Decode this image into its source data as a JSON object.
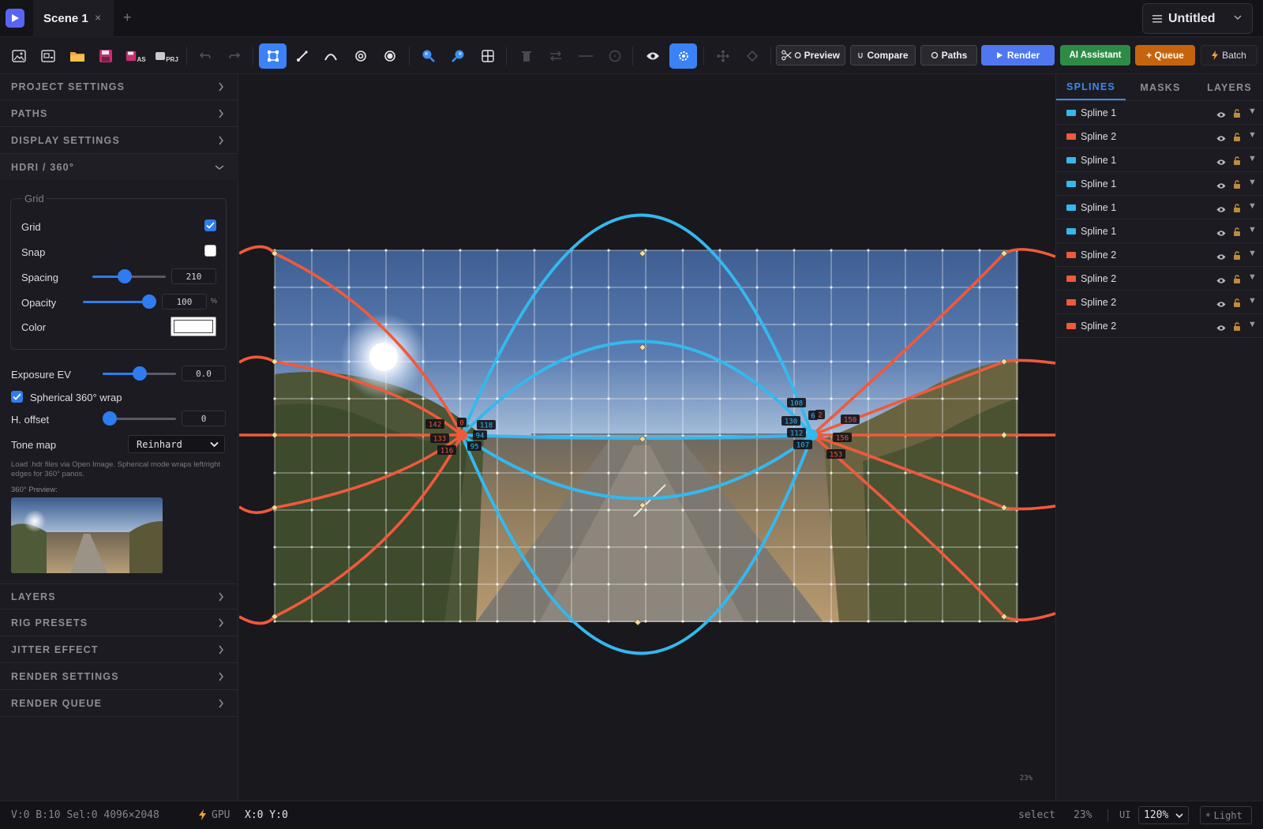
{
  "tabbar": {
    "tab_label": "Scene 1",
    "close": "×",
    "add": "+",
    "project_name": "Untitled"
  },
  "toolbar": {
    "icons": [
      "image-icon",
      "save-as-image-icon",
      "folder-open-icon",
      "save-icon",
      "save-as-icon",
      "save-project-icon",
      "undo-icon",
      "redo-icon",
      "select-tool-icon",
      "pen-tool-icon",
      "curve-tool-icon",
      "ring-tool-icon",
      "point-tool-icon",
      "zoom-in-icon",
      "zoom-out-icon",
      "grid-icon",
      "delete-icon",
      "swap-icon",
      "line-icon",
      "circle-icon",
      "eye-icon",
      "settings-icon",
      "move-icon",
      "diamond-icon"
    ],
    "save_as_badge": "AS",
    "project_badge": "PRJ",
    "preview": "Preview",
    "compare": "Compare",
    "paths": "Paths",
    "render": "Render",
    "ai": "AI Assistant",
    "queue": "+ Queue",
    "batch": "Batch",
    "colors": {
      "accent": "#3a82f6",
      "render": "#4f78f0",
      "ai": "#2e8b46",
      "queue": "#c5640f"
    }
  },
  "left": {
    "sections_top": [
      "PROJECT SETTINGS",
      "PATHS",
      "DISPLAY SETTINGS"
    ],
    "hdri_title": "HDRI / 360°",
    "grid": {
      "legend": "Grid",
      "grid_label": "Grid",
      "grid_on": true,
      "snap_label": "Snap",
      "snap_on": false,
      "spacing_label": "Spacing",
      "spacing_value": "210",
      "spacing_fraction": 0.42,
      "opacity_label": "Opacity",
      "opacity_value": "100",
      "opacity_unit": "%",
      "opacity_fraction": 1.0,
      "color_label": "Color",
      "color_value": "#ffffff"
    },
    "exposure_label": "Exposure EV",
    "exposure_value": "0.0",
    "exposure_fraction": 0.5,
    "wrap_label": "Spherical 360° wrap",
    "wrap_on": true,
    "hoffset_label": "H. offset",
    "hoffset_value": "0",
    "hoffset_fraction": 0.0,
    "tonemap_label": "Tone map",
    "tonemap_value": "Reinhard",
    "hint": "Load .hdr files via Open Image. Spherical mode wraps left/right edges for 360° panos.",
    "preview_label": "360° Preview:",
    "sections_bottom": [
      "LAYERS",
      "RIG PRESETS",
      "JITTER EFFECT",
      "RENDER SETTINGS",
      "RENDER QUEUE"
    ]
  },
  "canvas": {
    "zoom_label": "23%",
    "colors": {
      "blue": "#35b8ee",
      "red": "#ef5a3c",
      "handle": "#f2dca0"
    },
    "tags_left": [
      "142",
      "133",
      "116",
      "0",
      "118",
      "94",
      "95"
    ],
    "tags_right": [
      "108",
      "130",
      "112",
      "107",
      "6",
      "2",
      "150",
      "156",
      "153"
    ]
  },
  "right": {
    "tabs": [
      "SPLINES",
      "MASKS",
      "LAYERS"
    ],
    "splines": [
      {
        "name": "Spline 1",
        "color": "#35b8ee"
      },
      {
        "name": "Spline 2",
        "color": "#ef5a3c"
      },
      {
        "name": "Spline 1",
        "color": "#35b8ee"
      },
      {
        "name": "Spline 1",
        "color": "#35b8ee"
      },
      {
        "name": "Spline 1",
        "color": "#35b8ee"
      },
      {
        "name": "Spline 1",
        "color": "#35b8ee"
      },
      {
        "name": "Spline 2",
        "color": "#ef5a3c"
      },
      {
        "name": "Spline 2",
        "color": "#ef5a3c"
      },
      {
        "name": "Spline 2",
        "color": "#ef5a3c"
      },
      {
        "name": "Spline 2",
        "color": "#ef5a3c"
      }
    ]
  },
  "status": {
    "counts": "V:0 B:10 Sel:0 4096×2048",
    "gpu": "GPU",
    "coords": "X:0 Y:0",
    "mode": "select",
    "zoom": "23%",
    "ui_label": "UI",
    "ui_scale": "120%",
    "theme": "Light"
  }
}
